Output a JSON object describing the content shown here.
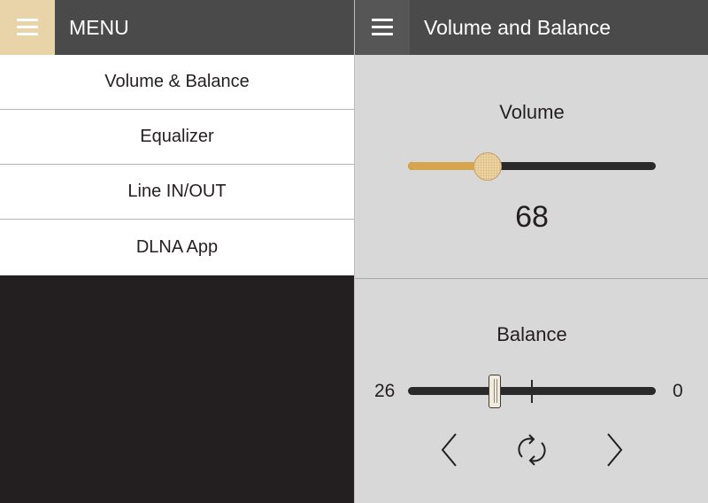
{
  "menu": {
    "title": "MENU",
    "items": [
      {
        "label": "Volume & Balance"
      },
      {
        "label": "Equalizer"
      },
      {
        "label": "Line IN/OUT"
      },
      {
        "label": "DLNA App"
      }
    ]
  },
  "header": {
    "title": "Volume and Balance"
  },
  "volume": {
    "label": "Volume",
    "value": "68",
    "slider_fraction": 0.32
  },
  "balance": {
    "label": "Balance",
    "left_value": "26",
    "right_value": "0",
    "slider_fraction": 0.35,
    "controls": [
      {
        "icon": "chevron-left-icon"
      },
      {
        "icon": "refresh-icon"
      },
      {
        "icon": "chevron-right-icon"
      }
    ]
  },
  "colors": {
    "accent": "#d6a64f",
    "menu_button_active": "#e8d4a8",
    "header": "#4a4a4a",
    "content_bg": "#d9d8d8"
  }
}
